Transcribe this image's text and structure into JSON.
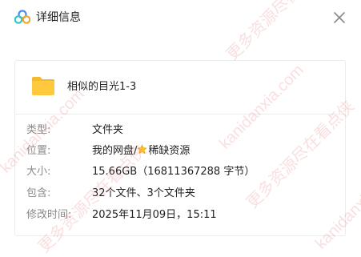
{
  "window": {
    "title": "详细信息",
    "logo_icon": "cloud-logo-icon",
    "close_icon": "close-icon"
  },
  "file": {
    "name": "相似的目光1-3",
    "icon": "folder-icon",
    "icon_color": "#FFC93D"
  },
  "details": [
    {
      "label": "类型:",
      "value": "文件夹"
    },
    {
      "label": "位置:",
      "value_prefix": "我的网盘/",
      "value_icon": "star-icon",
      "value_suffix": "稀缺资源"
    },
    {
      "label": "大小:",
      "value": "15.66GB（16811367288 字节）"
    },
    {
      "label": "包含:",
      "value": "32个文件、3个文件夹"
    },
    {
      "label": "修改时间:",
      "value": "2025年11月09日，15:11"
    }
  ],
  "watermark": {
    "text_1": "kanidanxia.com",
    "text_2": "更多资源尽在看点侠"
  }
}
